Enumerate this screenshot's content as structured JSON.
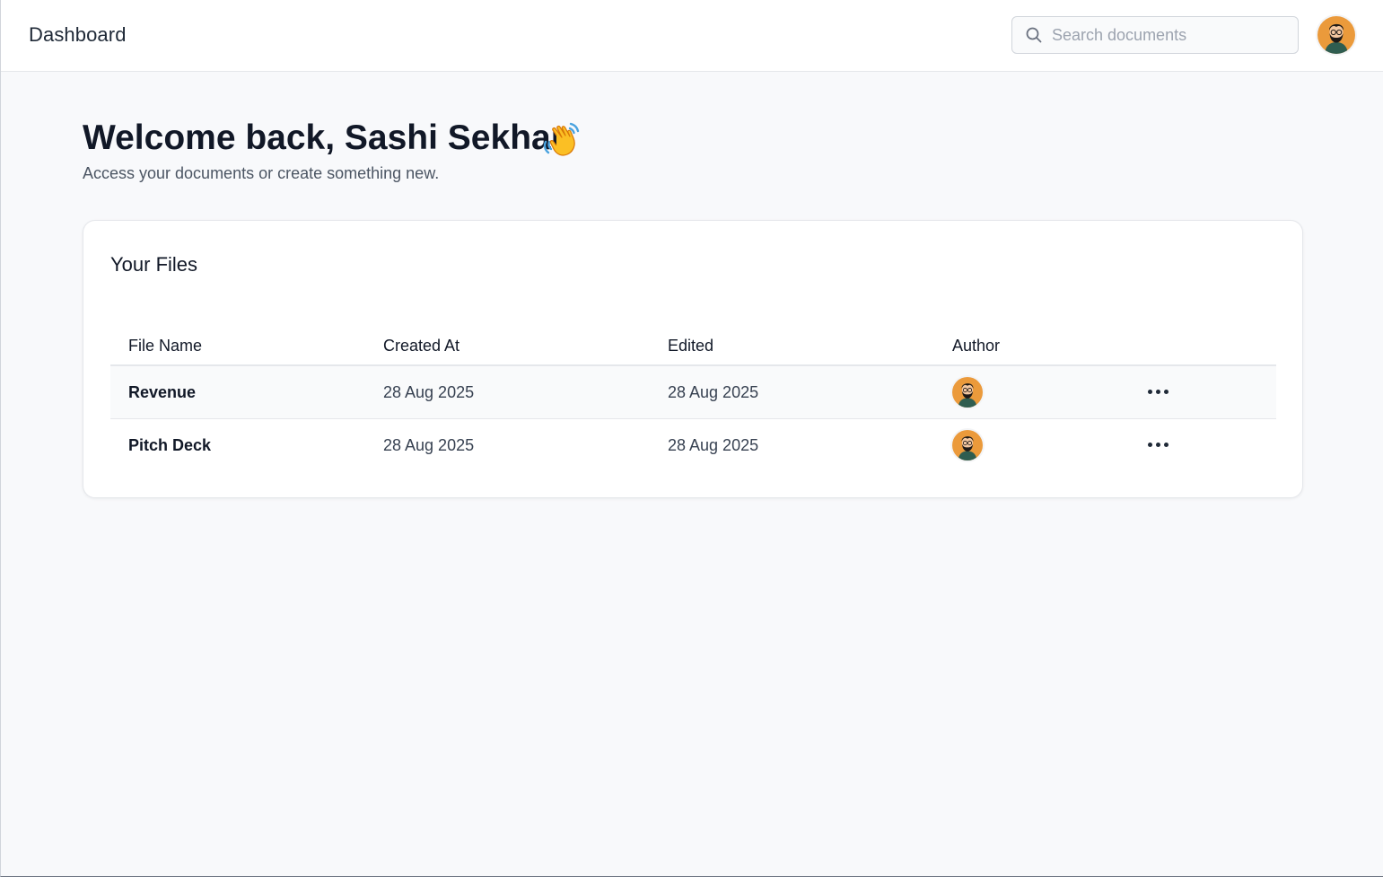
{
  "header": {
    "title": "Dashboard",
    "search": {
      "placeholder": "Search documents",
      "value": ""
    },
    "avatar_icon": "user-avatar-bearded-man"
  },
  "welcome": {
    "heading": "Welcome back, Sashi Sekhar",
    "emoji_icon": "waving-hand-icon",
    "subtitle": "Access your documents or create something new."
  },
  "files": {
    "title": "Your Files",
    "columns": [
      "File Name",
      "Created At",
      "Edited",
      "Author"
    ],
    "rows": [
      {
        "name": "Revenue",
        "created": "28 Aug 2025",
        "edited": "28 Aug 2025",
        "author_icon": "user-avatar-bearded-man",
        "actions_icon": "more-horizontal-icon"
      },
      {
        "name": "Pitch Deck",
        "created": "28 Aug 2025",
        "edited": "28 Aug 2025",
        "author_icon": "user-avatar-bearded-man",
        "actions_icon": "more-horizontal-icon"
      }
    ]
  },
  "colors": {
    "avatar_bg": "#eb9a3b",
    "page_bg": "#f8f9fb",
    "row_hover_bg": "#f9fafb",
    "heading": "#111827"
  }
}
